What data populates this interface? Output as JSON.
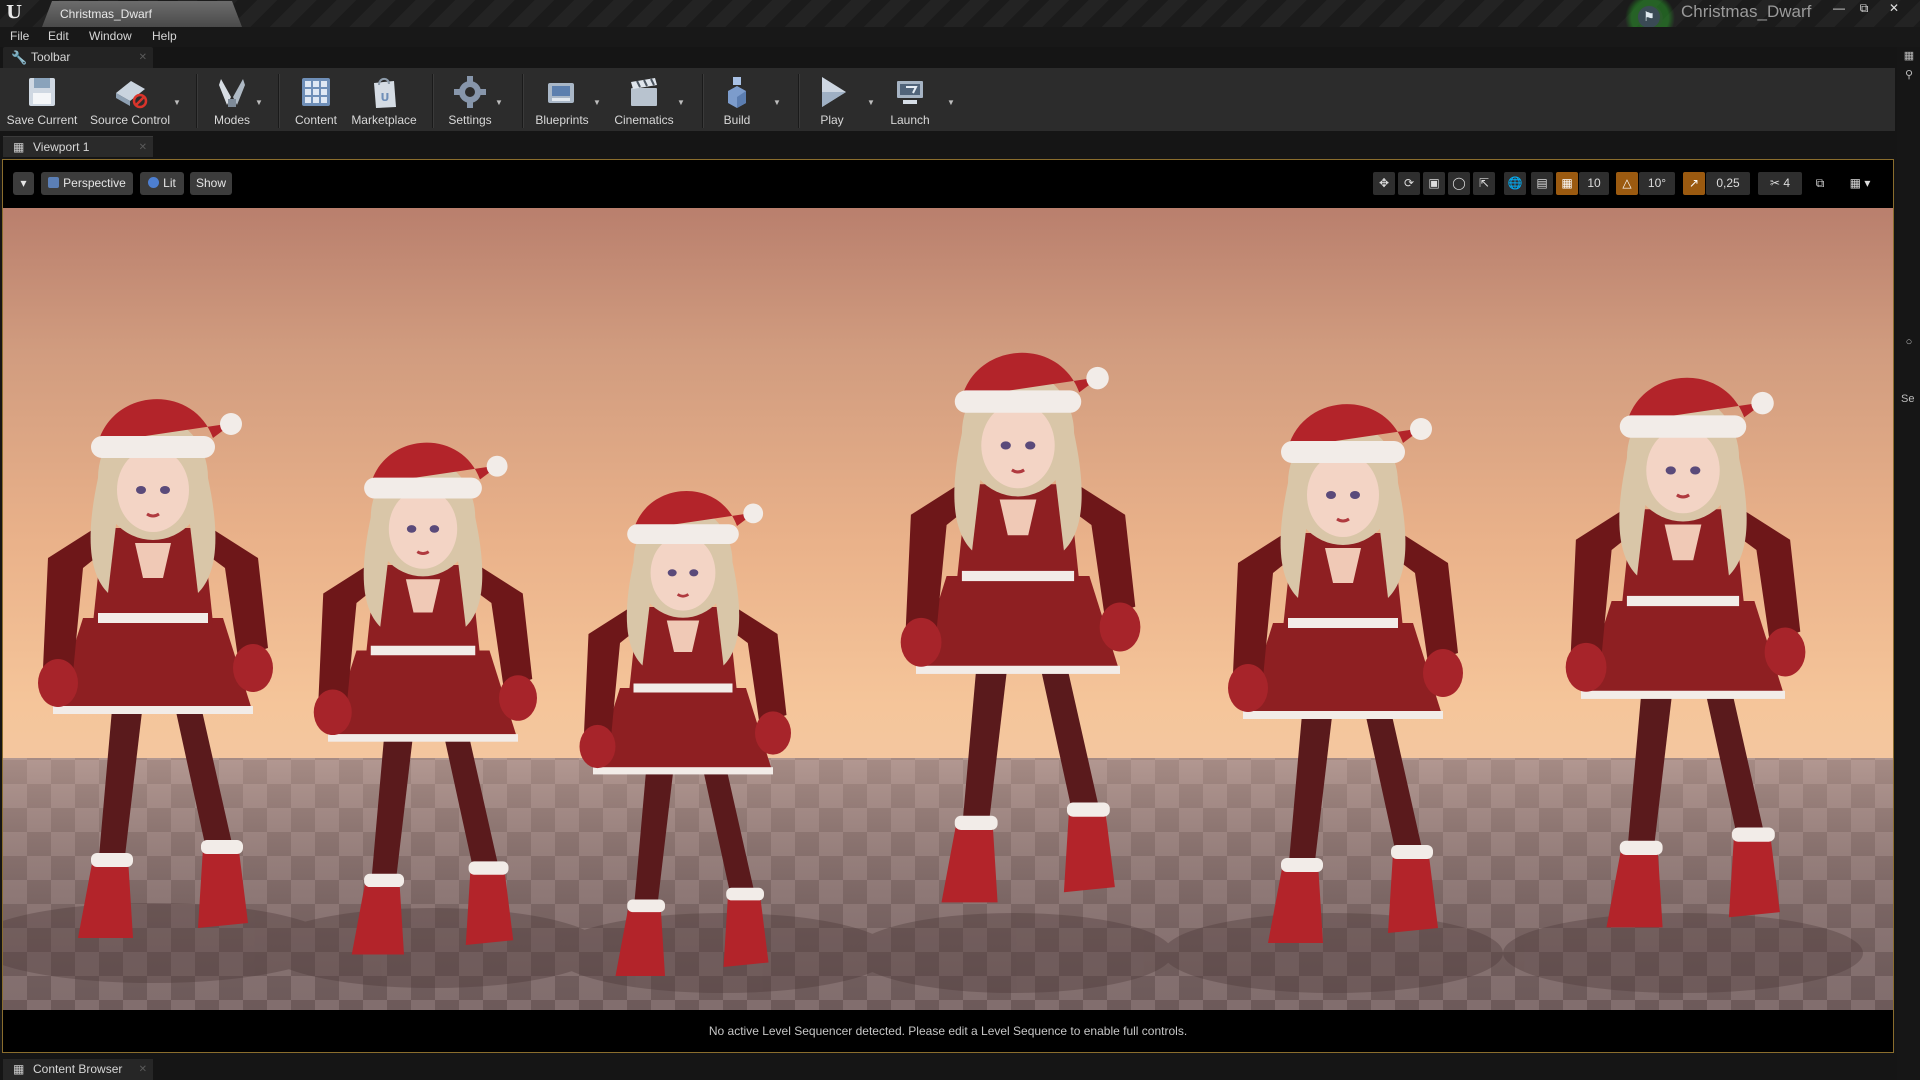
{
  "window": {
    "document_tab": "Christmas_Dwarf",
    "project_name": "Christmas_Dwarf",
    "controls": [
      "minimize-icon",
      "restore-icon",
      "close-icon"
    ]
  },
  "menu": [
    "File",
    "Edit",
    "Window",
    "Help"
  ],
  "toolbar_tab": {
    "label": "Toolbar",
    "icon": "wrench-icon"
  },
  "toolbar": {
    "save_current": "Save Current",
    "source_control": "Source Control",
    "modes": "Modes",
    "content": "Content",
    "marketplace": "Marketplace",
    "settings": "Settings",
    "blueprints": "Blueprints",
    "cinematics": "Cinematics",
    "build": "Build",
    "play": "Play",
    "launch": "Launch"
  },
  "viewport_tab": {
    "label": "Viewport 1",
    "icon": "viewport-grid-icon"
  },
  "viewport": {
    "view_mode": "Perspective",
    "lighting_mode": "Lit",
    "show": "Show",
    "grid_snap": "10",
    "rotation_snap": "10°",
    "scale_snap": "0,25",
    "camera_speed": "4",
    "accent": "#9b5a10",
    "selection_border": "#8a6d2d"
  },
  "scene": {
    "characters": 6,
    "sky_colors": [
      "#b97f6d",
      "#eab28a",
      "#f0cfb2"
    ],
    "outfit_colors": {
      "dress": "#8e1f22",
      "trim": "#f2ece8",
      "hair": "#d9c6a8",
      "stockings": "#5a1a1c"
    }
  },
  "sequencer_message": "No active Level Sequencer detected. Please edit a Level Sequence to enable full controls.",
  "content_browser_tab": {
    "label": "Content Browser",
    "icon": "content-browser-icon"
  },
  "right_panel": {
    "label": "Se"
  }
}
